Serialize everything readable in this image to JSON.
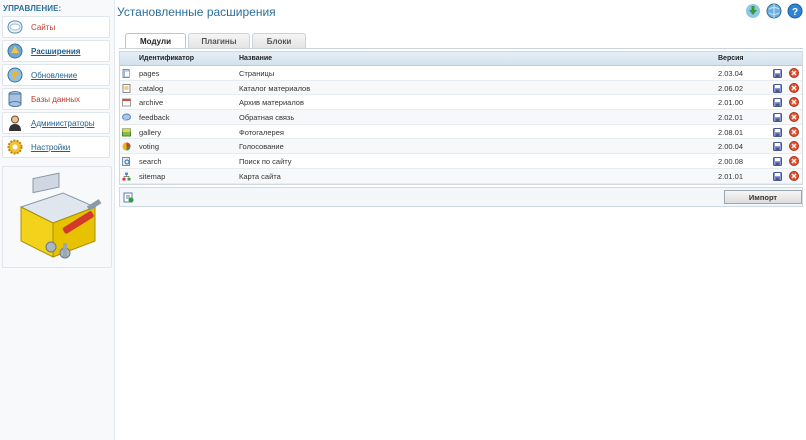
{
  "sidebar": {
    "heading": "УПРАВЛЕНИЕ:",
    "items": [
      {
        "label": "Сайты",
        "icon": "sites-icon"
      },
      {
        "label": "Расширения",
        "icon": "extensions-icon"
      },
      {
        "label": "Обновление",
        "icon": "update-icon"
      },
      {
        "label": "Базы данных",
        "icon": "database-icon"
      },
      {
        "label": "Администраторы",
        "icon": "admin-icon"
      },
      {
        "label": "Настройки",
        "icon": "settings-icon"
      }
    ]
  },
  "header": {
    "title": "Установленные расширения",
    "icons": [
      "download-icon",
      "web-icon",
      "help-icon"
    ]
  },
  "tabs": [
    "Модули",
    "Плагины",
    "Блоки"
  ],
  "table": {
    "columns": {
      "id": "Идентификатор",
      "name": "Название",
      "version": "Версия"
    },
    "rows": [
      {
        "id": "pages",
        "name": "Страницы",
        "version": "2.03.04",
        "icon": "pages-icon"
      },
      {
        "id": "catalog",
        "name": "Каталог материалов",
        "version": "2.06.02",
        "icon": "catalog-icon"
      },
      {
        "id": "archive",
        "name": "Архив материалов",
        "version": "2.01.00",
        "icon": "archive-icon"
      },
      {
        "id": "feedback",
        "name": "Обратная связь",
        "version": "2.02.01",
        "icon": "feedback-icon"
      },
      {
        "id": "gallery",
        "name": "Фотогалерея",
        "version": "2.08.01",
        "icon": "gallery-icon"
      },
      {
        "id": "voting",
        "name": "Голосование",
        "version": "2.00.04",
        "icon": "voting-icon"
      },
      {
        "id": "search",
        "name": "Поиск по сайту",
        "version": "2.00.08",
        "icon": "search-icon"
      },
      {
        "id": "sitemap",
        "name": "Карта сайта",
        "version": "2.01.01",
        "icon": "sitemap-icon"
      }
    ]
  },
  "footer": {
    "import_label": "Импорт"
  },
  "colors": {
    "accent": "#2d6f9c",
    "danger": "#c0392b",
    "header_bg": "#d3e2ee"
  }
}
